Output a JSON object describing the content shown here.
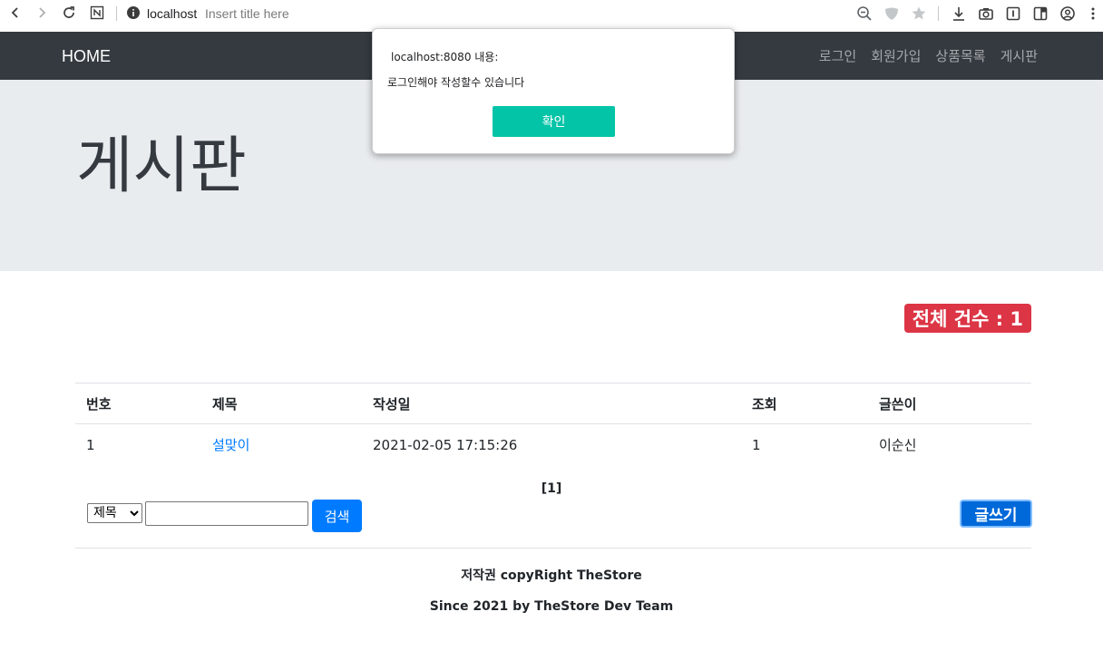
{
  "browser": {
    "host": "localhost",
    "page_title": "Insert title here"
  },
  "navbar": {
    "brand": "HOME",
    "links": [
      "로그인",
      "회원가입",
      "상품목록",
      "게시판"
    ]
  },
  "jumbotron": {
    "heading": "게시판"
  },
  "count_badge": "전체 건수 : 1",
  "table": {
    "headers": [
      "번호",
      "제목",
      "작성일",
      "조회",
      "글쓴이"
    ],
    "rows": [
      {
        "no": "1",
        "title": "설맞이",
        "date": "2021-02-05 17:15:26",
        "views": "1",
        "author": "이순신"
      }
    ]
  },
  "pager": "[1]",
  "search": {
    "field_selected": "제목",
    "query": "",
    "button": "검색"
  },
  "write_button": "글쓰기",
  "footer": {
    "line1": "저작권 copyRight TheStore",
    "line2": "Since 2021 by TheStore Dev Team"
  },
  "dialog": {
    "title": "localhost:8080 내용:",
    "message": "로그인해야 작성할수 있습니다",
    "ok": "확인"
  },
  "colors": {
    "navbar": "#343a40",
    "jumbotron": "#e9ecef",
    "badge": "#dc3545",
    "primary": "#007bff",
    "dialog_ok": "#04c4a8"
  },
  "icons": [
    "back-icon",
    "forward-icon",
    "reload-icon",
    "notion-icon",
    "info-icon",
    "zoom-icon",
    "shield-icon",
    "star-icon",
    "download-icon",
    "camera-icon",
    "reader-icon",
    "sidebar-icon",
    "profile-icon",
    "menu-icon"
  ]
}
